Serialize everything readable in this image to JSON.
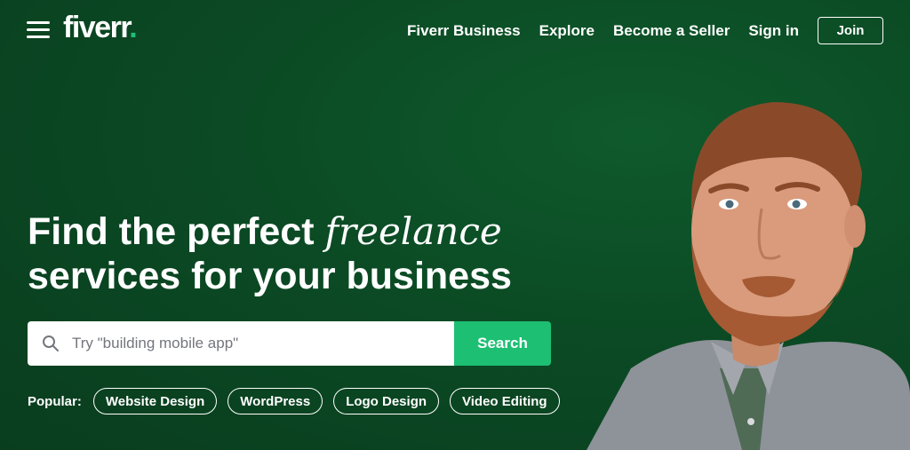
{
  "header": {
    "logo_text": "fiverr",
    "logo_dot": ".",
    "nav": {
      "business": "Fiverr Business",
      "explore": "Explore",
      "seller": "Become a Seller",
      "signin": "Sign in",
      "join": "Join"
    }
  },
  "hero": {
    "headline_part1": "Find the perfect ",
    "headline_emphasis": "freelance",
    "headline_line2": "services for your business"
  },
  "search": {
    "placeholder": "Try \"building mobile app\"",
    "button": "Search"
  },
  "popular": {
    "label": "Popular:",
    "tags": [
      "Website Design",
      "WordPress",
      "Logo Design",
      "Video Editing"
    ]
  },
  "colors": {
    "background": "#0b4a24",
    "accent": "#1dbf73"
  }
}
